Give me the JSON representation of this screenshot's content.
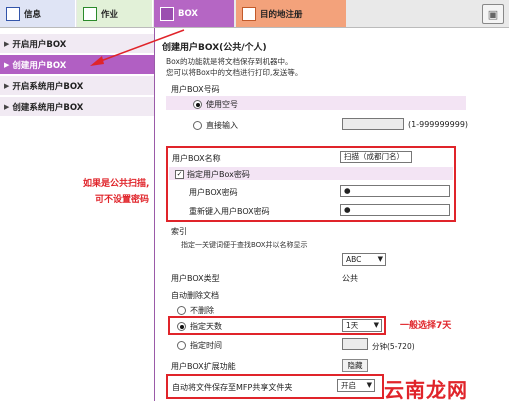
{
  "tabs": {
    "info": "信息",
    "job": "作业",
    "box": "BOX",
    "destination": "目的地注册"
  },
  "sidebar": {
    "items": [
      {
        "label": "开启用户BOX"
      },
      {
        "label": "创建用户BOX"
      },
      {
        "label": "开启系统用户BOX"
      },
      {
        "label": "创建系统用户BOX"
      }
    ]
  },
  "form": {
    "title": "创建用户BOX(公共/个人)",
    "desc_line1": "Box的功能就是将文档保存到机器中。",
    "desc_line2": "您可以将Box中的文档进行打印,发送等。",
    "box_number_label": "用户BOX号码",
    "use_empty_label": "使用空号",
    "direct_input_label": "直接输入",
    "direct_input_value": "",
    "direct_input_range": "(1-999999999)",
    "box_name_label": "用户BOX名称",
    "box_name_value": "扫描（成都门名）",
    "specify_password_label": "指定用户Box密码",
    "password_label": "用户BOX密码",
    "password_value": "●",
    "reenter_password_label": "重新键入用户BOX密码",
    "reenter_password_value": "●",
    "index_label": "索引",
    "index_desc": "指定一关键词便于查找BOX并以名称显示",
    "index_value": "ABC",
    "box_type_label": "用户BOX类型",
    "box_type_value": "公共",
    "auto_delete_label": "自动删除文档",
    "no_delete_label": "不删除",
    "specify_days_label": "指定天数",
    "days_value": "1天",
    "specify_time_label": "指定时间",
    "time_value": "",
    "time_unit": "分钟(5-720)",
    "extension_label": "用户BOX扩展功能",
    "hide_button": "隐藏",
    "auto_save_label": "自动将文件保存至MFP共享文件夹",
    "auto_save_value": "开启"
  },
  "annotations": {
    "public_scan_line1": "如果是公共扫描,",
    "public_scan_line2": "可不设置密码",
    "choose_7days": "一般选择7天"
  },
  "watermark": "云南龙网",
  "colors": {
    "accent_purple": "#b15fc3",
    "annotation_red": "#e0242a"
  }
}
